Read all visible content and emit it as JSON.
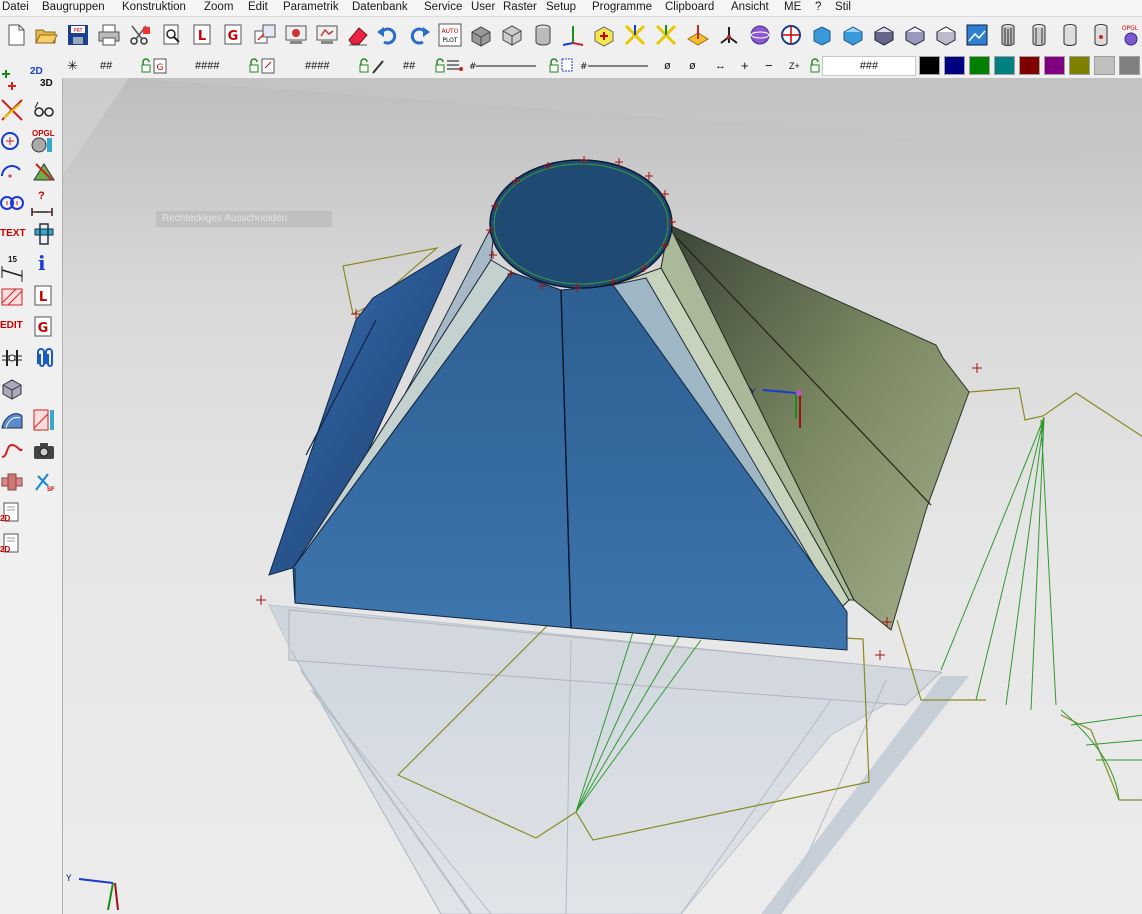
{
  "menu": {
    "items": [
      "Datei",
      "Baugruppen",
      "Konstruktion",
      "Zoom",
      "Edit",
      "Parametrik",
      "Datenbank",
      "Service",
      "User",
      "Raster",
      "Setup",
      "Programme",
      "Clipboard",
      "Ansicht",
      "ME",
      "?",
      "Stil"
    ]
  },
  "toolbar_top": {
    "icons": [
      "new-file-icon",
      "open-folder-icon",
      "save-part-icon",
      "print-icon",
      "cut-icon",
      "preview-icon",
      "layer-l-icon",
      "layer-g-icon",
      "export-icon",
      "render-icon",
      "render2-icon",
      "eraser-icon",
      "undo-icon",
      "redo-icon",
      "autoplot-icon",
      "solid-icon",
      "box-icon",
      "cylinder-icon",
      "axes-icon",
      "plus-box-icon",
      "xaxis-icon",
      "yaxis-icon",
      "zaxis-icon",
      "origin-icon",
      "sphere-icon",
      "globe-icon",
      "view-front-icon",
      "view-top-icon",
      "view-iso-icon",
      "view-iso2-icon",
      "view-iso3-icon",
      "image-icon",
      "barrel-icon",
      "cylinder2-icon",
      "cylinder3-icon",
      "cylinder4-icon",
      "opgl-icon"
    ],
    "autoplot_label": "AUTO PLOT",
    "opgl_label": "OPGL"
  },
  "toolbar_second": {
    "snap_star": "✳",
    "hash1": "##",
    "hash2": "####",
    "hash3": "####",
    "hash4": "##",
    "angle1": "ø",
    "angle2": "ø",
    "lr_arrows": "↔",
    "plus": "+",
    "minus": "−",
    "z_plus": "Z+",
    "text_field": "###",
    "colors": [
      "#000000",
      "#000080",
      "#008000",
      "#008080",
      "#800000",
      "#800080",
      "#808000",
      "#c0c0c0",
      "#808080"
    ]
  },
  "left_toolbar": {
    "label_2d3d_top": "2D",
    "label_2d3d_bottom": "3D",
    "label_opgl": "OPGL",
    "label_text": "TEXT",
    "label_edit": "EDIT",
    "label_dim": "15",
    "label_question": "?",
    "label_info": "i",
    "label_sf": "SF",
    "label_2d_a": "2D",
    "label_2d_b": "2D"
  },
  "viewport": {
    "status_tip": "Rechteckiges Ausschneiden",
    "axis_y": "Y",
    "axis_y_small": "Y",
    "colors": {
      "model_blue": "#3d6b99",
      "model_olive": "#7c8a5e",
      "outline_olive": "#8a8a22",
      "line_green": "#2f9a2f",
      "marker_red": "#a01010"
    }
  }
}
